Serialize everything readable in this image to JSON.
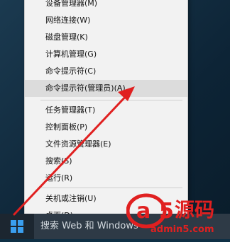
{
  "menu": {
    "items": [
      {
        "label": "设备管理器(M)"
      },
      {
        "label": "网络连接(W)"
      },
      {
        "label": "磁盘管理(K)"
      },
      {
        "label": "计算机管理(G)"
      },
      {
        "label": "命令提示符(C)"
      },
      {
        "label": "命令提示符(管理员)(A)"
      },
      {
        "label": "任务管理器(T)"
      },
      {
        "label": "控制面板(P)"
      },
      {
        "label": "文件资源管理器(E)"
      },
      {
        "label": "搜索(S)"
      },
      {
        "label": "运行(R)"
      },
      {
        "label": "关机或注销(U)"
      },
      {
        "label": "桌面(D)"
      }
    ]
  },
  "taskbar": {
    "search_placeholder": "搜索 Web 和 Windows"
  },
  "watermark": {
    "logo": "a5源码",
    "site": "admin5.com"
  },
  "colors": {
    "accent_red": "#e02020",
    "menu_bg": "#f2f2f2",
    "highlight": "#dcdcdc",
    "windows_blue": "#3a9ff0"
  },
  "icons": [
    "windows-logo-icon",
    "red-arrow"
  ]
}
